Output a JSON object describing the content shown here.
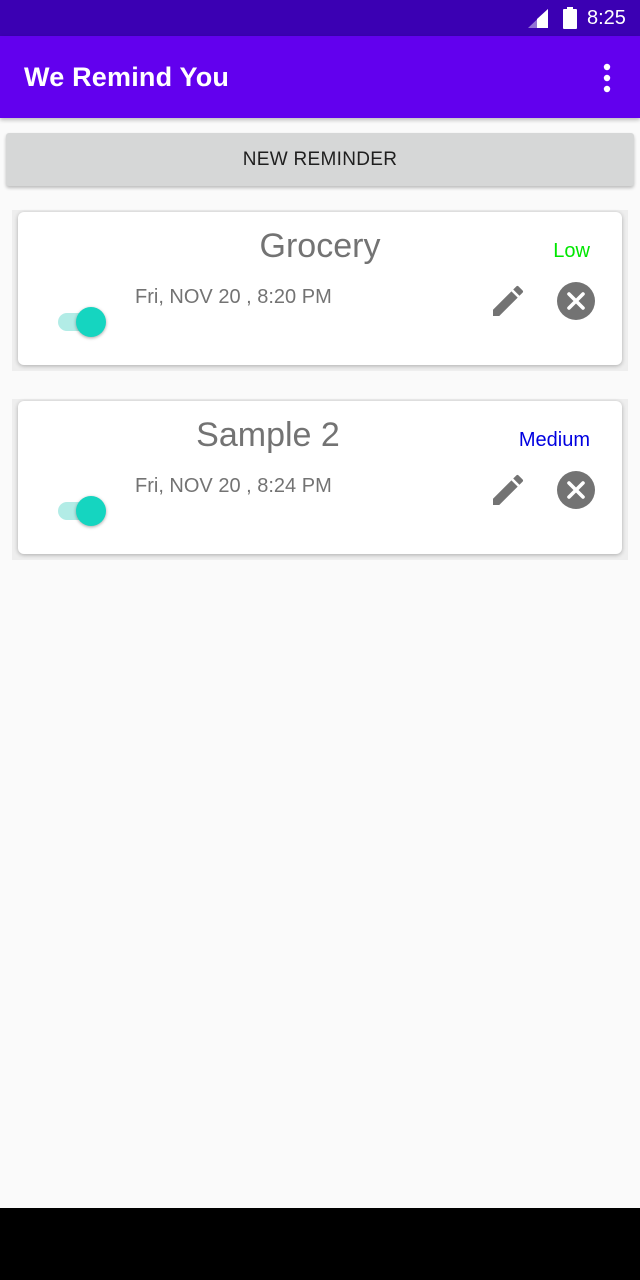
{
  "status_bar": {
    "time": "8:25",
    "icons": [
      "signal-icon",
      "battery-icon"
    ]
  },
  "app_bar": {
    "title": "We Remind You",
    "overflow_icon": "more-vert-icon"
  },
  "new_reminder_button": {
    "label": "NEW REMINDER"
  },
  "reminders": [
    {
      "name": "Grocery",
      "datetime": "Fri, NOV 20 , 8:20 PM",
      "priority": "Low",
      "priority_color": "#00e600",
      "enabled": true
    },
    {
      "name": "Sample 2",
      "datetime": "Fri, NOV 20 , 8:24 PM",
      "priority": "Medium",
      "priority_color": "#0000e0",
      "enabled": true
    }
  ],
  "colors": {
    "status_bar": "#3b00b3",
    "app_bar": "#6200ee",
    "toggle_on": "#15d5c0",
    "icon_gray": "#737373"
  }
}
